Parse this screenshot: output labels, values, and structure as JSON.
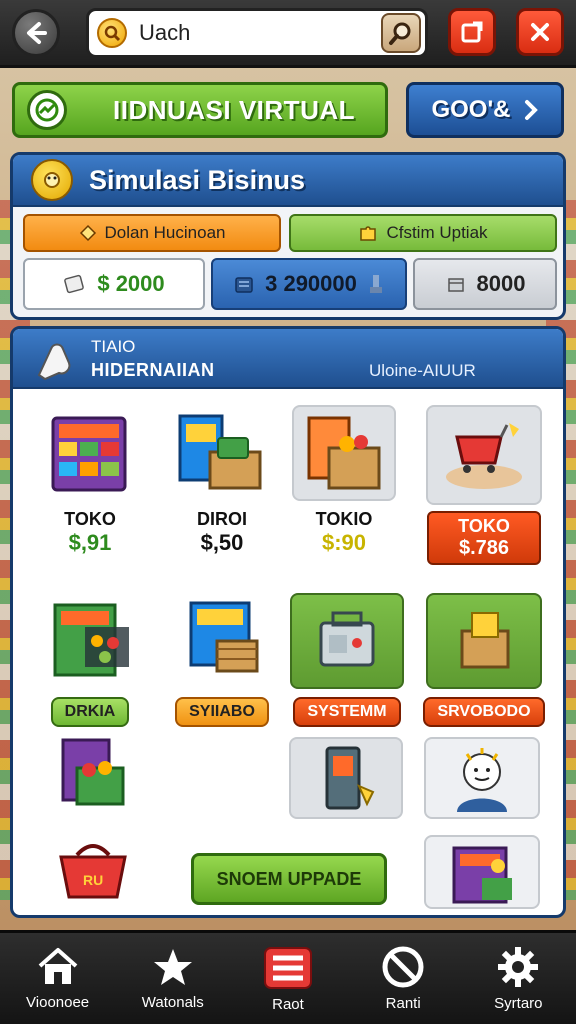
{
  "top_bar": {
    "search_text": "Uach",
    "icons": [
      "back-arrow-icon",
      "logo-icon",
      "search-icon",
      "share-icon",
      "close-icon"
    ]
  },
  "banner": {
    "label": "IIDNUASI VIRTUAL",
    "go_label": "GOO'&"
  },
  "simulation": {
    "title": "Simulasi Bisinus",
    "tab_left": "Dolan Hucinoan",
    "tab_right": "Cfstim Uptiak",
    "stats": [
      "$ 2000",
      "3 290000",
      "8000"
    ]
  },
  "shop": {
    "header_line1": "TIAIO",
    "header_line2": "HIDERNAIIAN",
    "header_right": "Uloine-AIUUR",
    "items": [
      {
        "name": "TOKO",
        "price": "$,91"
      },
      {
        "name": "DIROI",
        "price": "$,50"
      },
      {
        "name": "TOKIO",
        "price": "$:90"
      },
      {
        "name": "TOKO",
        "price": "$.786"
      }
    ],
    "pills": [
      "DRKIA",
      "SYIIABO",
      "SYSTEMM",
      "SRVOBODO"
    ],
    "upgrade_label": "SNOEM UPPADE"
  },
  "bottom_nav": [
    "Vioonoee",
    "Watonals",
    "Raot",
    "Ranti",
    "Syrtaro"
  ],
  "colors": {
    "accent_green": "#5ea623",
    "accent_blue": "#1f4f8f",
    "accent_red": "#d92d12",
    "price_green": "#2e8b1e"
  }
}
